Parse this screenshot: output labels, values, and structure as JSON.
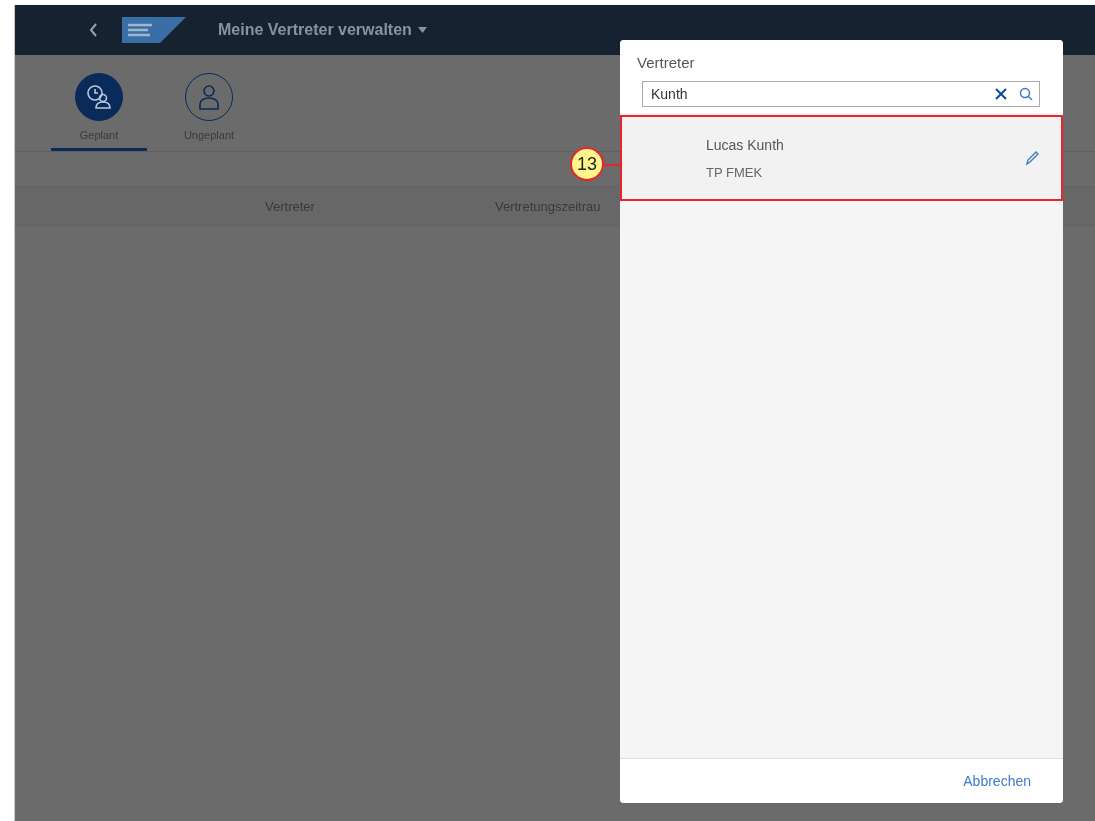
{
  "shell": {
    "title": "Meine Vertreter verwalten"
  },
  "tabs": [
    {
      "label": "Geplant",
      "kind": "planned",
      "selected": true
    },
    {
      "label": "Ungeplant",
      "kind": "person",
      "selected": false
    }
  ],
  "table": {
    "columns": [
      "Vertreter",
      "Vertretungszeitrau"
    ]
  },
  "dialog": {
    "title": "Vertreter",
    "search": {
      "value": "Kunth"
    },
    "results": [
      {
        "name": "Lucas Kunth",
        "subtitle": "TP FMEK",
        "highlighted": true
      }
    ],
    "cancel": "Abbrechen"
  },
  "callout": {
    "number": "13"
  }
}
